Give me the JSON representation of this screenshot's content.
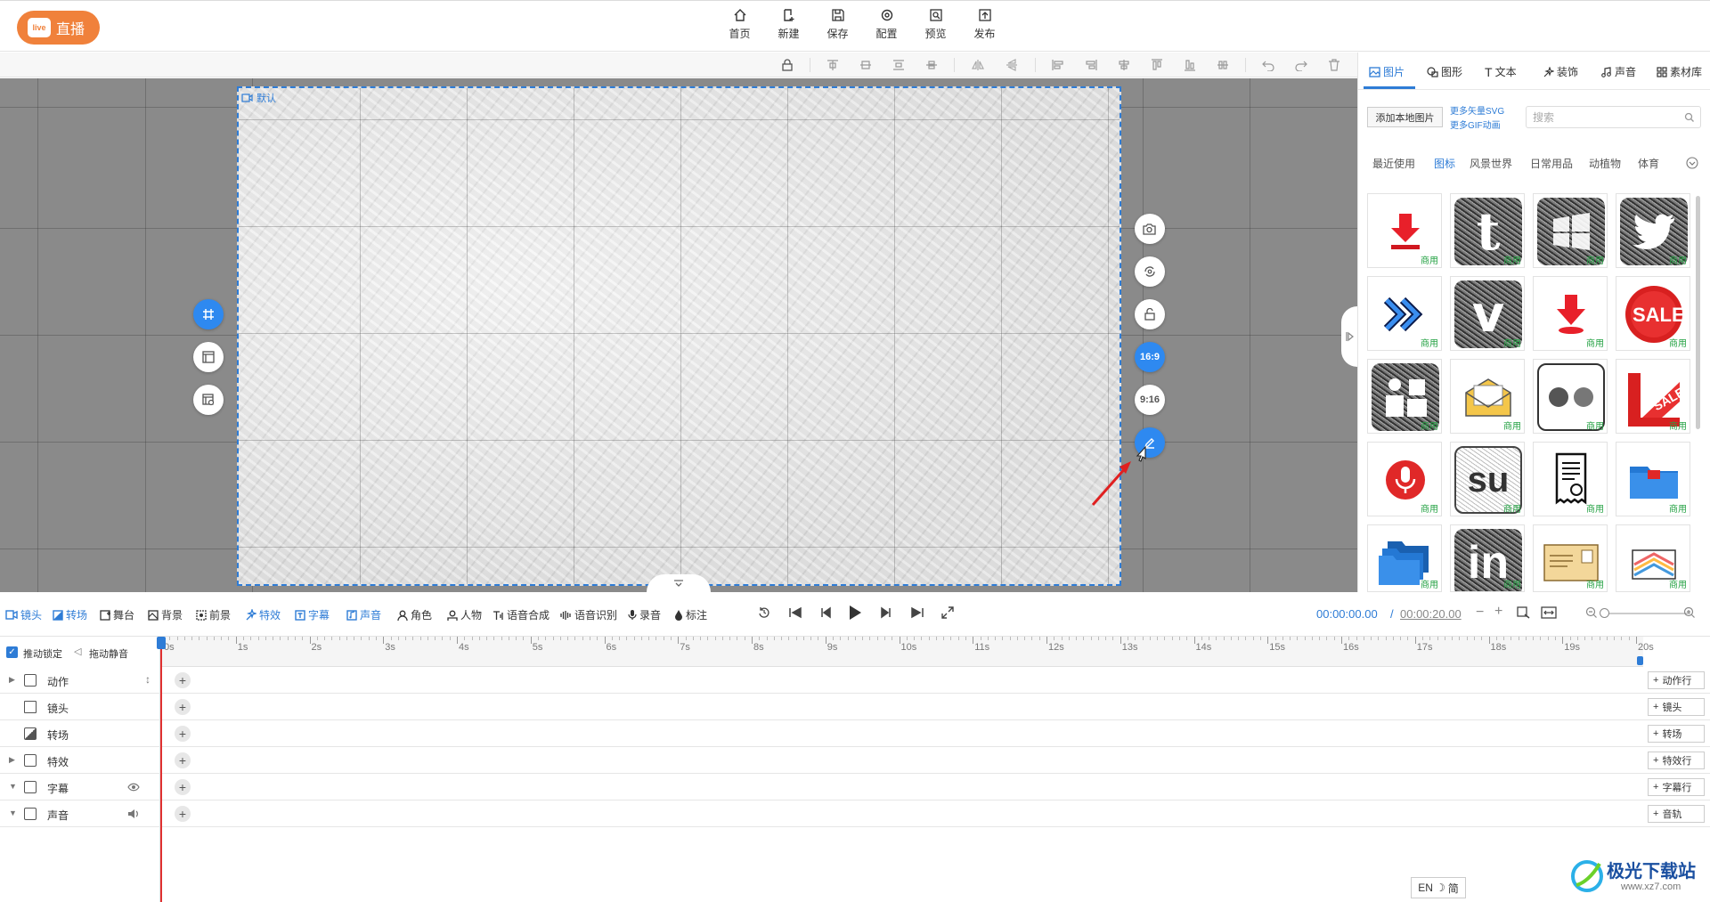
{
  "header": {
    "live_label": "直播",
    "live_icon_text": "live",
    "nav": [
      {
        "label": "首页",
        "icon": "home-icon"
      },
      {
        "label": "新建",
        "icon": "new-file-icon"
      },
      {
        "label": "保存",
        "icon": "save-icon"
      },
      {
        "label": "配置",
        "icon": "settings-icon"
      },
      {
        "label": "预览",
        "icon": "preview-icon"
      },
      {
        "label": "发布",
        "icon": "publish-icon"
      }
    ]
  },
  "canvas": {
    "scene_label": "默认",
    "ratio_16_9": "16:9",
    "ratio_9_16": "9:16",
    "accent": "#2e7cd6"
  },
  "right_panel": {
    "tabs": [
      {
        "label": "图片"
      },
      {
        "label": "图形"
      },
      {
        "label": "文本"
      },
      {
        "label": "装饰"
      },
      {
        "label": "声音"
      },
      {
        "label": "素材库"
      }
    ],
    "add_local": "添加本地图片",
    "more_svg": "更多矢量SVG",
    "more_gif": "更多GIF动画",
    "search_placeholder": "搜索",
    "categories": [
      "最近使用",
      "图标",
      "风景世界",
      "日常用品",
      "动植物",
      "体育"
    ],
    "commercial_tag": "商用",
    "sale_text": "SALE"
  },
  "controls": {
    "left": [
      {
        "label": "镜头",
        "active": true
      },
      {
        "label": "转场",
        "active": true
      },
      {
        "label": "舞台",
        "active": false
      },
      {
        "label": "背景",
        "active": false
      },
      {
        "label": "前景",
        "active": false
      },
      {
        "label": "特效",
        "active": true
      },
      {
        "label": "字幕",
        "active": true
      },
      {
        "label": "声音",
        "active": true
      },
      {
        "label": "角色",
        "active": false
      },
      {
        "label": "人物",
        "active": false
      },
      {
        "label": "语音合成",
        "active": false
      },
      {
        "label": "语音识别",
        "active": false
      },
      {
        "label": "录音",
        "active": false
      },
      {
        "label": "标注",
        "active": false
      }
    ],
    "time_current": "00:00:00.00",
    "time_separator": "/",
    "time_total": "00:00:20.00"
  },
  "timeline": {
    "lock_label": "推动锁定",
    "mute_label": "拖动静音",
    "ticks": [
      "0s",
      "1s",
      "2s",
      "3s",
      "4s",
      "5s",
      "6s",
      "7s",
      "8s",
      "9s",
      "10s",
      "11s",
      "12s",
      "13s",
      "14s",
      "15s",
      "16s",
      "17s",
      "18s",
      "19s",
      "20s"
    ],
    "rows": [
      {
        "label": "动作",
        "add": "动作行",
        "expandable": true
      },
      {
        "label": "镜头",
        "add": "镜头",
        "expandable": false
      },
      {
        "label": "转场",
        "add": "转场",
        "expandable": false
      },
      {
        "label": "特效",
        "add": "特效行",
        "expandable": true
      },
      {
        "label": "字幕",
        "add": "字幕行",
        "expandable": true
      },
      {
        "label": "声音",
        "add": "音轨",
        "expandable": true
      }
    ]
  },
  "ime": {
    "lang": "EN",
    "mode": "简"
  },
  "watermark": {
    "name": "极光下载站",
    "url": "www.xz7.com"
  }
}
